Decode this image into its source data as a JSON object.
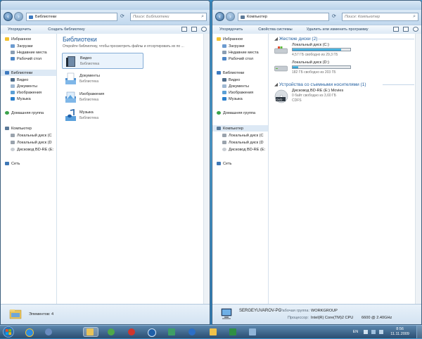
{
  "colors": {
    "accent": "#1e5c9e",
    "drive_bar": "#1d8fc9",
    "selection": "#dde9f5",
    "taskbar": "#2a4e72"
  },
  "left_window": {
    "address": "Библиотеки",
    "address_icon": "libraries-icon",
    "search_placeholder": "Поиск: Библиотеки",
    "commands": [
      "Упорядочить",
      "Создать библиотеку"
    ],
    "nav": [
      {
        "label": "Избранное",
        "icon": "star-icon"
      },
      {
        "label": "Загрузки",
        "icon": "downloads-icon"
      },
      {
        "label": "Недавние места",
        "icon": "recent-places-icon"
      },
      {
        "label": "Рабочий стол",
        "icon": "desktop-icon"
      },
      {
        "label": "Библиотеки",
        "icon": "libraries-icon"
      },
      {
        "label": "Видео",
        "icon": "video-icon"
      },
      {
        "label": "Документы",
        "icon": "documents-icon"
      },
      {
        "label": "Изображения",
        "icon": "pictures-icon"
      },
      {
        "label": "Музыка",
        "icon": "music-icon"
      },
      {
        "label": "Домашняя группа",
        "icon": "homegroup-icon"
      },
      {
        "label": "Компьютер",
        "icon": "computer-icon"
      },
      {
        "label": "Локальный диск (С",
        "icon": "hard-drive-icon"
      },
      {
        "label": "Локальный диск (D",
        "icon": "hard-drive-icon"
      },
      {
        "label": "Дисковод BD-RE (E:",
        "icon": "disc-drive-icon"
      },
      {
        "label": "Сеть",
        "icon": "network-icon"
      }
    ],
    "title": "Библиотеки",
    "subtitle": "Откройте библиотеку, чтобы просмотреть файлы и отсортировать их по ...",
    "libraries": [
      {
        "name": "Видео",
        "caption": "Библиотека",
        "icon": "video-library-icon"
      },
      {
        "name": "Документы",
        "caption": "Библиотека",
        "icon": "documents-library-icon"
      },
      {
        "name": "Изображения",
        "caption": "Библиотека",
        "icon": "pictures-library-icon"
      },
      {
        "name": "Музыка",
        "caption": "Библиотека",
        "icon": "music-library-icon"
      }
    ],
    "details": "Элементов: 4"
  },
  "right_window": {
    "address": "Компьютер",
    "address_icon": "computer-icon",
    "search_placeholder": "Поиск: Компьютер",
    "commands": [
      "Упорядочить",
      "Свойства системы",
      "Удалить или изменить программу"
    ],
    "nav": [
      {
        "label": "Избранное",
        "icon": "star-icon"
      },
      {
        "label": "Загрузки",
        "icon": "downloads-icon"
      },
      {
        "label": "Недавние места",
        "icon": "recent-places-icon"
      },
      {
        "label": "Рабочий стол",
        "icon": "desktop-icon"
      },
      {
        "label": "Библиотеки",
        "icon": "libraries-icon"
      },
      {
        "label": "Видео",
        "icon": "video-icon"
      },
      {
        "label": "Документы",
        "icon": "documents-icon"
      },
      {
        "label": "Изображения",
        "icon": "pictures-icon"
      },
      {
        "label": "Музыка",
        "icon": "music-icon"
      },
      {
        "label": "Домашняя группа",
        "icon": "homegroup-icon"
      },
      {
        "label": "Компьютер",
        "icon": "computer-icon"
      },
      {
        "label": "Локальный диск (С",
        "icon": "hard-drive-icon"
      },
      {
        "label": "Локальный диск (D",
        "icon": "hard-drive-icon"
      },
      {
        "label": "Дисковод BD-RE (E:",
        "icon": "disc-drive-icon"
      },
      {
        "label": "Сеть",
        "icon": "network-icon"
      }
    ],
    "hard_disks_header": "Жесткие диски (2)",
    "drives": [
      {
        "name": "Локальный диск (C:)",
        "free": "4,57 ГБ свободно из 29,3 ГБ",
        "used_fraction": 0.84,
        "icon": "windows-drive-icon"
      },
      {
        "name": "Локальный диск (D:)",
        "free": "182 ГБ свободно из 203 ГБ",
        "used_fraction": 0.1,
        "icon": "hard-drive-icon"
      }
    ],
    "removable_header": "Устройства со съемными носителями (1)",
    "removable": {
      "name": "Дисковод BD-RE (E:) Movies",
      "free": "0 байт свободно из 3,60 ГБ",
      "fs": "CDFS",
      "icon": "dvd-disc-icon"
    },
    "pc_name": "SERGEYUVAROV-PC",
    "workgroup_label": "Рабочая группа:",
    "workgroup": "WORKGROUP",
    "processor_label": "Процессор:",
    "processor": "Intel(R) Core(TM)2 CPU",
    "processor_speed": "6600 @ 2.40GHz"
  },
  "taskbar": {
    "start_icon": "windows-start-icon",
    "apps": [
      {
        "icon": "ie-icon"
      },
      {
        "icon": "browser-icon"
      },
      {
        "icon": "explorer-folder-icon",
        "active": true
      },
      {
        "icon": "green-app-icon"
      },
      {
        "icon": "red-app-icon"
      },
      {
        "icon": "media-player-icon"
      },
      {
        "icon": "tool-icon"
      },
      {
        "icon": "blue-app-icon"
      },
      {
        "icon": "mail-icon"
      },
      {
        "icon": "excel-icon"
      },
      {
        "icon": "photo-icon"
      }
    ],
    "language": "EN",
    "time": "8:56",
    "date": "11.11.2009"
  }
}
